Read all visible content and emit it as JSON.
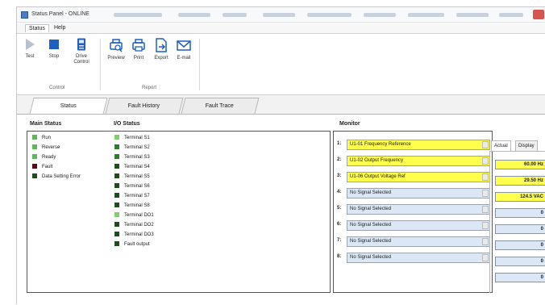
{
  "window": {
    "title": "Status Panel - ONLINE"
  },
  "menu": {
    "items": [
      "Status",
      "Help"
    ]
  },
  "ribbon": {
    "control_group": "Control",
    "report_group": "Report",
    "buttons": [
      {
        "label": "Test",
        "icon": "play-icon"
      },
      {
        "label": "Stop",
        "icon": "stop-icon"
      },
      {
        "label": "Drive Control",
        "icon": "drive-icon"
      },
      {
        "label": "Preview",
        "icon": "preview-icon"
      },
      {
        "label": "Print",
        "icon": "print-icon"
      },
      {
        "label": "Export",
        "icon": "export-icon"
      },
      {
        "label": "E-mail",
        "icon": "email-icon"
      }
    ]
  },
  "tabs": [
    "Status",
    "Fault History",
    "Fault Trace"
  ],
  "main_status": {
    "header": "Main Status",
    "items": [
      {
        "label": "Run",
        "color": "#5cb85c"
      },
      {
        "label": "Reverse",
        "color": "#5cb85c"
      },
      {
        "label": "Ready",
        "color": "#5cb85c"
      },
      {
        "label": "Fault",
        "color": "#5a0a14"
      },
      {
        "label": "Data Setting Error",
        "color": "#1f4d1f"
      }
    ]
  },
  "io_status": {
    "header": "I/O Status",
    "items": [
      {
        "label": "Terminal S1",
        "color": "#7fcf6f"
      },
      {
        "label": "Terminal S2",
        "color": "#2e7d2e"
      },
      {
        "label": "Terminal S3",
        "color": "#2e7d2e"
      },
      {
        "label": "Terminal S4",
        "color": "#1f4d1f"
      },
      {
        "label": "Terminal S5",
        "color": "#1f4d1f"
      },
      {
        "label": "Terminal S6",
        "color": "#1f4d1f"
      },
      {
        "label": "Terminal S7",
        "color": "#1f4d1f"
      },
      {
        "label": "Terminal S8",
        "color": "#1f4d1f"
      },
      {
        "label": "Terminal DO1",
        "color": "#7fcf6f"
      },
      {
        "label": "Terminal DO2",
        "color": "#1f4d1f"
      },
      {
        "label": "Terminal DO3",
        "color": "#1f4d1f"
      },
      {
        "label": "Fault output",
        "color": "#1f4d1f"
      }
    ]
  },
  "monitor": {
    "header": "Monitor",
    "rows": [
      {
        "num": "1:",
        "label": "U1-01 Frequency Reference",
        "highlight": true
      },
      {
        "num": "2:",
        "label": "U1-02 Output Frequency",
        "highlight": true
      },
      {
        "num": "3:",
        "label": "U1-06 Output Voltage Ref",
        "highlight": true
      },
      {
        "num": "4:",
        "label": "No Signal Selected",
        "highlight": false
      },
      {
        "num": "5:",
        "label": "No Signal Selected",
        "highlight": false
      },
      {
        "num": "6:",
        "label": "No Signal Selected",
        "highlight": false
      },
      {
        "num": "7:",
        "label": "No Signal Selected",
        "highlight": false
      },
      {
        "num": "8:",
        "label": "No Signal Selected",
        "highlight": false
      }
    ]
  },
  "actual": {
    "tab_actual": "Actual",
    "tab_display": "Display",
    "values": [
      {
        "text": "60.00 Hz",
        "highlight": true
      },
      {
        "text": "29.50 Hz",
        "highlight": true
      },
      {
        "text": "124.5 VAC",
        "highlight": true
      },
      {
        "text": "0",
        "highlight": false
      },
      {
        "text": "0",
        "highlight": false
      },
      {
        "text": "0",
        "highlight": false
      },
      {
        "text": "0",
        "highlight": false
      },
      {
        "text": "0",
        "highlight": false
      }
    ]
  }
}
